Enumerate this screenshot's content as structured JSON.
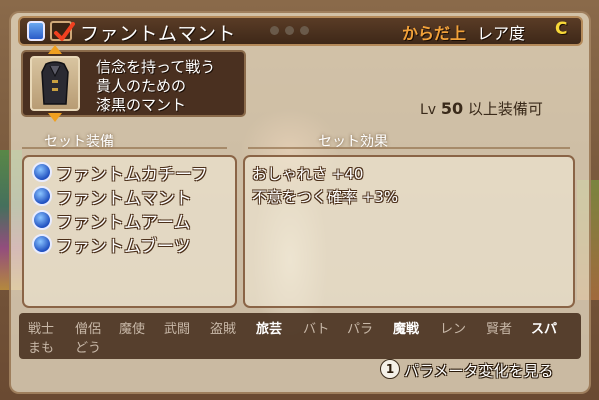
{
  "header": {
    "item_name": "ファントムマント",
    "slot": "からだ上",
    "rarity_label": "レア度",
    "rarity_value": "C"
  },
  "description": {
    "lines": [
      "信念を持って戦う",
      "貴人のための",
      "漆黒のマント"
    ]
  },
  "level": {
    "prefix": "Lv",
    "value": "50",
    "suffix": "以上装備可"
  },
  "set_equipment": {
    "header": "セット装備",
    "items": [
      {
        "name": "ファントムカチーフ",
        "icon": "head-armor-icon"
      },
      {
        "name": "ファントムマント",
        "icon": "body-armor-icon"
      },
      {
        "name": "ファントムアーム",
        "icon": "arm-armor-icon"
      },
      {
        "name": "ファントムブーツ",
        "icon": "boots-armor-icon"
      }
    ]
  },
  "set_effect": {
    "header": "セット効果",
    "effects": [
      "おしゃれさ +40",
      "不意をつく確率 +3%"
    ]
  },
  "vocations": [
    {
      "label": "戦士",
      "active": false
    },
    {
      "label": "僧侶",
      "active": false
    },
    {
      "label": "魔使",
      "active": false
    },
    {
      "label": "武闘",
      "active": false
    },
    {
      "label": "盗賊",
      "active": false
    },
    {
      "label": "旅芸",
      "active": true
    },
    {
      "label": "バト",
      "active": false
    },
    {
      "label": "パラ",
      "active": false
    },
    {
      "label": "魔戦",
      "active": true
    },
    {
      "label": "レン",
      "active": false
    },
    {
      "label": "賢者",
      "active": false
    },
    {
      "label": "スパ",
      "active": true
    },
    {
      "label": "まも",
      "active": false
    },
    {
      "label": "どう",
      "active": false
    }
  ],
  "footer": {
    "button": "1",
    "text": "パラメータ変化を見る"
  },
  "colors": {
    "slot": "#f2a23a",
    "rarity": "#f8d838",
    "title_bg": "#3e2818"
  }
}
